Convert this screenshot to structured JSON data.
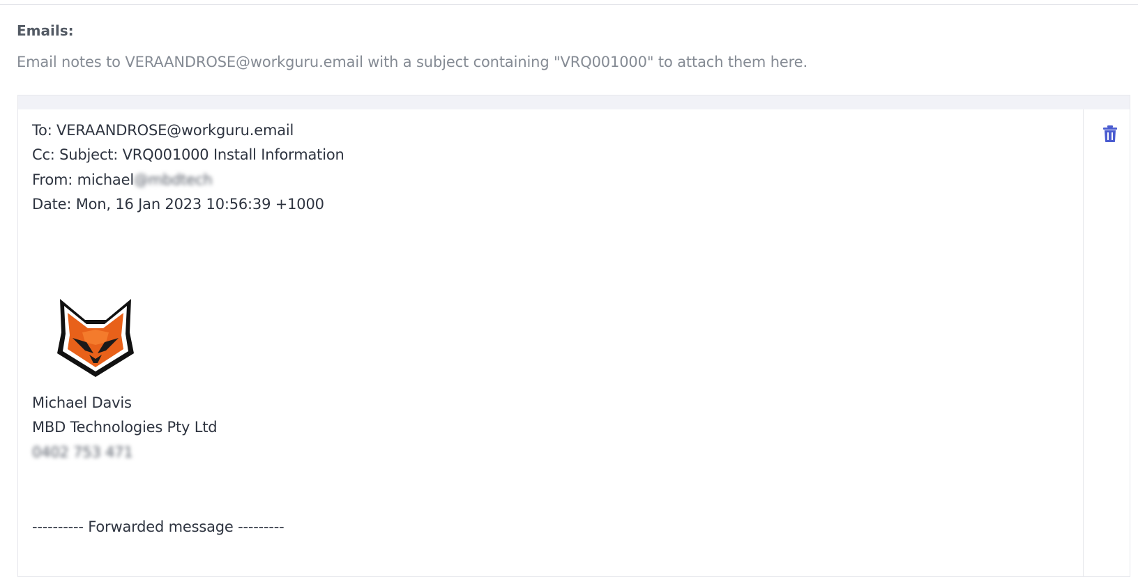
{
  "emails_section": {
    "label": "Emails:",
    "description": "Email notes to VERAANDROSE@workguru.email with a subject containing \"VRQ001000\" to attach them here."
  },
  "email": {
    "to_line": "To: VERAANDROSE@workguru.email",
    "cc_subject_line": "Cc: Subject: VRQ001000 Install Information",
    "from_prefix": "From: michael",
    "from_redacted": "@mbdtech",
    "date_line": "Date: Mon, 16 Jan 2023 10:56:39 +1000",
    "signature_name": "Michael Davis",
    "signature_company": "MBD Technologies Pty Ltd",
    "signature_phone_redacted": "0402 753 471",
    "forwarded_divider": "---------- Forwarded message ---------"
  },
  "icons": {
    "delete": "trash-icon",
    "logo": "fox-logo-icon"
  },
  "colors": {
    "accent": "#4a5cd0",
    "fox_orange": "#e8611a",
    "header_band": "#f1f2f7"
  }
}
